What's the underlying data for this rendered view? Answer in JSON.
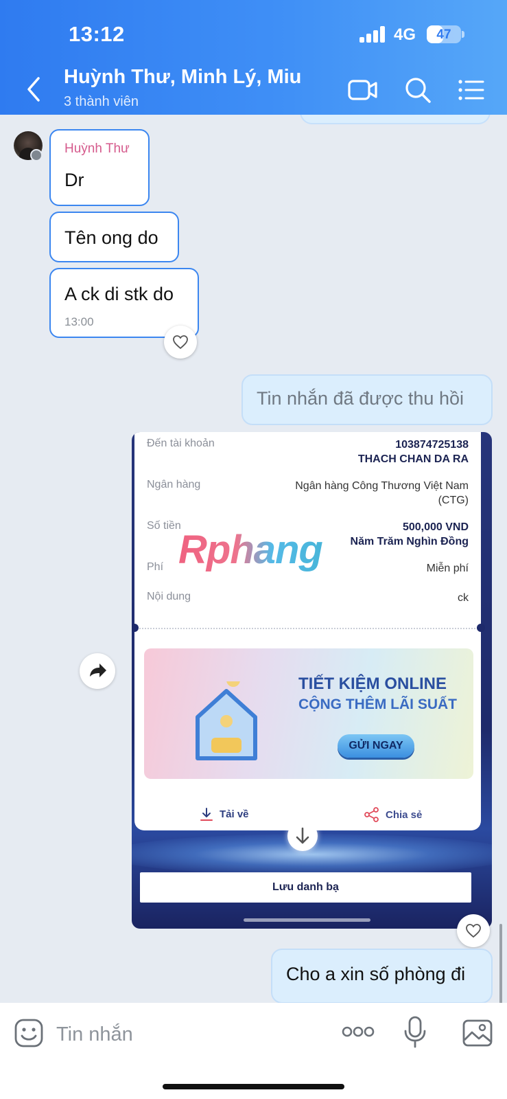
{
  "status_bar": {
    "time": "13:12",
    "network": "4G",
    "battery": "47",
    "battery_level": 0.47
  },
  "header": {
    "title": "Huỳnh Thư, Minh Lý, Miu",
    "subtitle": "3 thành viên"
  },
  "messages": {
    "sender_name": "Huỳnh Thư",
    "incoming": [
      {
        "text": "Dr"
      },
      {
        "text": "Tên ong do"
      },
      {
        "text": "A ck di stk do",
        "time": "13:00"
      }
    ],
    "recalled": "Tin nhắn đã được thu hồi",
    "outgoing_last": "Cho a xin số phòng đi"
  },
  "receipt": {
    "to_account_label": "Đến tài khoản",
    "account_number": "103874725138",
    "account_name": "THACH CHAN DA RA",
    "bank_label": "Ngân hàng",
    "bank_value_line1": "Ngân hàng Công Thương Việt Nam",
    "bank_value_line2": "(CTG)",
    "amount_label": "Số tiền",
    "amount": "500,000 VND",
    "amount_words": "Năm Trăm Nghìn Đồng",
    "fee_label": "Phí",
    "fee": "Miễn phí",
    "content_label": "Nội dung",
    "content": "ck",
    "watermark": "Rphang",
    "banner_line1": "TIẾT KIỆM ONLINE",
    "banner_line2": "CỘNG THÊM LÃI SUẤT",
    "banner_button": "GỬI NGAY",
    "download": "Tải về",
    "share": "Chia sẻ",
    "save_contact": "Lưu danh bạ"
  },
  "composer": {
    "placeholder": "Tin nhắn"
  },
  "colors": {
    "header_start": "#2f7bf0",
    "header_end": "#56a7f8",
    "incoming_border": "#3b86f0",
    "outgoing_bg": "#dbeefd",
    "sender_name": "#d55a8c"
  }
}
